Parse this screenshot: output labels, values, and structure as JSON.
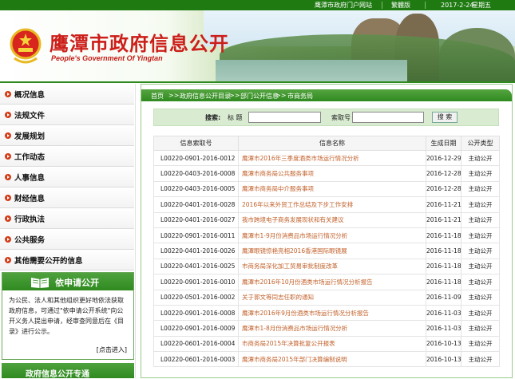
{
  "topbar": {
    "portal_link": "鹰潭市政府门户网站",
    "traditional": "繁體版",
    "date": "2017-2-24",
    "weekday": "星期五"
  },
  "banner": {
    "title": "鹰潭市政府信息公开",
    "subtitle": "People's Government Of Yingtan"
  },
  "sidebar": {
    "items": [
      {
        "label": "概况信息"
      },
      {
        "label": "法规文件"
      },
      {
        "label": "发展规划"
      },
      {
        "label": "工作动态"
      },
      {
        "label": "人事信息"
      },
      {
        "label": "财经信息"
      },
      {
        "label": "行政执法"
      },
      {
        "label": "公共服务"
      },
      {
        "label": "其他需要公开的信息"
      }
    ],
    "apply": {
      "title": "依申请公开",
      "body": "为公民、法人和其他组织更好地依法获取政府信息，可通过\"依申请公开系统\"向公开义务人提出申请，经审查同意后在《目录》进行公示。",
      "link": "[点击进入]"
    },
    "bottom_tab": "政府信息公开专通"
  },
  "breadcrumb": {
    "home": "首页",
    "sep": ">>",
    "catalog": "政府信息公开目录",
    "dept": "部门公开信息",
    "current": "市商务局"
  },
  "search": {
    "label": "搜索:",
    "title_label": "标 题",
    "index_label": "索取号",
    "title_value": "",
    "index_value": "",
    "button": "搜 索"
  },
  "table": {
    "headers": [
      "信息索取号",
      "信息名称",
      "生成日期",
      "公开类型"
    ],
    "rows": [
      {
        "idx": "L00220-0901-2016-0012",
        "name": "鹰潭市2016年三季度酒类市场运行情况分析",
        "date": "2016-12-29",
        "type": "主动公开"
      },
      {
        "idx": "L00220-0403-2016-0008",
        "name": "鹰潭市商务局公共服务事项",
        "date": "2016-12-28",
        "type": "主动公开"
      },
      {
        "idx": "L00220-0403-2016-0005",
        "name": "鹰潭市商务局中介服务事项",
        "date": "2016-12-28",
        "type": "主动公开"
      },
      {
        "idx": "L00220-0401-2016-0028",
        "name": "2016年以来外贸工作总结及下步工作安排",
        "date": "2016-11-21",
        "type": "主动公开"
      },
      {
        "idx": "L00220-0401-2016-0027",
        "name": "我市跨境电子商务发展现状和有关建议",
        "date": "2016-11-21",
        "type": "主动公开"
      },
      {
        "idx": "L00220-0901-2016-0011",
        "name": "鹰潭市1-9月份消费品市场运行情况分析",
        "date": "2016-11-18",
        "type": "主动公开"
      },
      {
        "idx": "L00220-0401-2016-0026",
        "name": "鹰潭眼镜惊艳亮相2016香港国际眼镜展",
        "date": "2016-11-18",
        "type": "主动公开"
      },
      {
        "idx": "L00220-0401-2016-0025",
        "name": "市商务局深化加工贸易审批制度改革",
        "date": "2016-11-18",
        "type": "主动公开"
      },
      {
        "idx": "L00220-0901-2016-0010",
        "name": "鹰潭市2016年10月份酒类市场运行情况分析报告",
        "date": "2016-11-18",
        "type": "主动公开"
      },
      {
        "idx": "L00220-0501-2016-0002",
        "name": "关于郭文等同志任职的通知",
        "date": "2016-11-09",
        "type": "主动公开"
      },
      {
        "idx": "L00220-0901-2016-0008",
        "name": "鹰潭市2016年9月份酒类市场运行情况分析报告",
        "date": "2016-11-03",
        "type": "主动公开"
      },
      {
        "idx": "L00220-0901-2016-0009",
        "name": "鹰潭市1-8月份消费品市场运行情况分析",
        "date": "2016-11-03",
        "type": "主动公开"
      },
      {
        "idx": "L00220-0601-2016-0004",
        "name": "市商务局2015年决算批复公开报表",
        "date": "2016-10-13",
        "type": "主动公开"
      },
      {
        "idx": "L00220-0601-2016-0003",
        "name": "鹰潭市商务局2015年部门决算编制说明",
        "date": "2016-10-13",
        "type": "主动公开"
      }
    ]
  }
}
